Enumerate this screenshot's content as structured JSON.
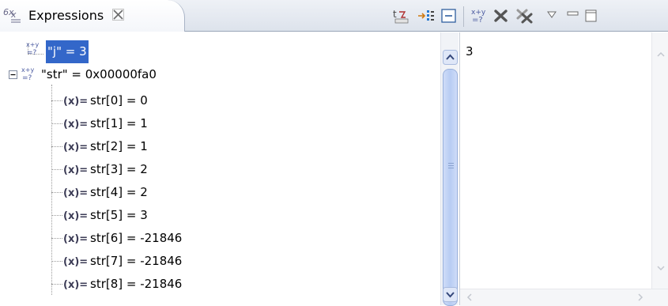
{
  "view": {
    "tab_title": "Expressions",
    "tab_icon": "expressions-view-icon",
    "close_icon": "close-tab-icon"
  },
  "toolbar": [
    {
      "name": "show-type-names-button",
      "icon": "type-names-icon"
    },
    {
      "name": "show-logical-structure-button",
      "icon": "logical-structure-icon"
    },
    {
      "name": "collapse-all-button",
      "icon": "collapse-all-icon"
    },
    {
      "name": "add-watch-expression-button",
      "icon": "add-expression-icon"
    },
    {
      "name": "remove-expression-button",
      "icon": "remove-icon"
    },
    {
      "name": "remove-all-expressions-button",
      "icon": "remove-all-icon"
    },
    {
      "name": "view-menu-button",
      "icon": "view-menu-icon"
    },
    {
      "name": "minimize-button",
      "icon": "minimize-icon"
    },
    {
      "name": "maximize-button",
      "icon": "maximize-icon"
    }
  ],
  "tree": {
    "expressions": [
      {
        "label": "\"j\" = 3",
        "selected": true
      },
      {
        "label": "\"str\" = 0x00000fa0",
        "expanded": true,
        "children": [
          {
            "label": "str[0] = 0"
          },
          {
            "label": "str[1] = 1"
          },
          {
            "label": "str[2] = 1"
          },
          {
            "label": "str[3] = 2"
          },
          {
            "label": "str[4] = 2"
          },
          {
            "label": "str[5] = 3"
          },
          {
            "label": "str[6] = -21846"
          },
          {
            "label": "str[7] = -21846"
          },
          {
            "label": "str[8] = -21846"
          }
        ]
      }
    ],
    "var_icon_text": "(x)=",
    "expr_icon_text": "x+y"
  },
  "detail": {
    "value": "3"
  },
  "colors": {
    "selection": "#3367c9",
    "scroll_thumb": "#b7ccf3"
  }
}
